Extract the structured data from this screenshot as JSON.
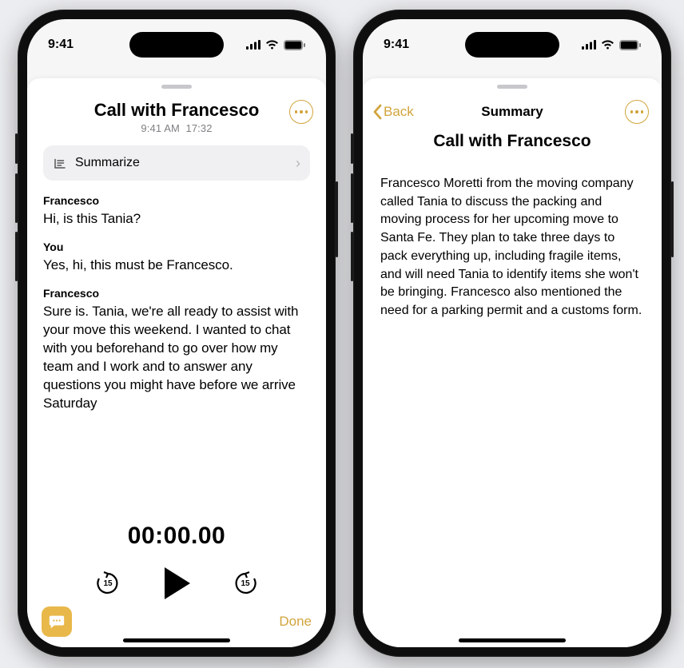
{
  "status": {
    "time": "9:41"
  },
  "left": {
    "title": "Call with Francesco",
    "subtitle_time": "9:41 AM",
    "subtitle_duration": "17:32",
    "summarize_label": "Summarize",
    "transcript": {
      "turns": [
        {
          "speaker": "Francesco",
          "text": "Hi, is this Tania?"
        },
        {
          "speaker": "You",
          "text": "Yes, hi, this must be Francesco."
        },
        {
          "speaker": "Francesco",
          "text": "Sure is. Tania, we're all ready to assist with your move this weekend. I wanted to chat with you beforehand to go over how my team and I work and to answer any questions you might have before we arrive Saturday",
          "fade_tail": true
        }
      ]
    },
    "player": {
      "timecode": "00:00.00",
      "skip_seconds": "15"
    },
    "done_label": "Done"
  },
  "right": {
    "back_label": "Back",
    "header_title": "Summary",
    "title": "Call with Francesco",
    "body": "Francesco Moretti from the moving company called Tania to discuss the packing and moving process for her upcoming move to Santa Fe. They plan to take three days to pack everything up, including fragile items, and will need Tania to identify items she won't be bringing. Francesco also mentioned the need for a parking permit and a customs form."
  },
  "colors": {
    "accent": "#d1a43c"
  }
}
